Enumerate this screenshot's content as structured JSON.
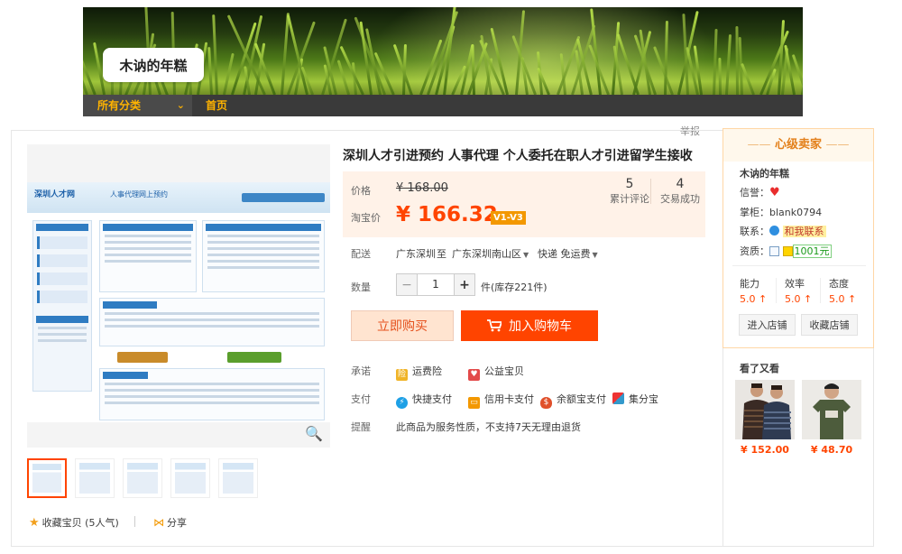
{
  "shop": {
    "banner_name": "木讷的年糕"
  },
  "nav": {
    "all_categories": "所有分类",
    "chevron": "⌄",
    "home": "首页"
  },
  "report": "举报",
  "product": {
    "title": "深圳人才引进预约 人事代理 个人委托在职人才引进留学生接收",
    "price_label": "价格",
    "original_price": "¥ 168.00",
    "taobao_price_label": "淘宝价",
    "sale_price": "¥ 166.32",
    "vip_badge": "V1-V3",
    "reviews_count": "5",
    "reviews_label": "累计评论",
    "deals_count": "4",
    "deals_label": "交易成功"
  },
  "delivery": {
    "label": "配送",
    "from": "广东深圳",
    "to_word": "至",
    "to": "广东深圳南山区",
    "shipping": "快递 免运费"
  },
  "quantity": {
    "label": "数量",
    "minus": "−",
    "value": "1",
    "plus": "+",
    "unit_stock": "件(库存221件)"
  },
  "actions": {
    "buy_now": "立即购买",
    "add_to_cart": "加入购物车"
  },
  "promise": {
    "label": "承诺",
    "items": [
      "运费险",
      "公益宝贝"
    ]
  },
  "payment": {
    "label": "支付",
    "items": [
      "快捷支付",
      "信用卡支付",
      "余额宝支付",
      "集分宝"
    ]
  },
  "notice": {
    "label": "提醒",
    "text": "此商品为服务性质，不支持7天无理由退货"
  },
  "social": {
    "favorite": "收藏宝贝 (5人气)",
    "share": "分享"
  },
  "seller": {
    "heading": "心级卖家",
    "shop_name": "木讷的年糕",
    "reputation_label": "信誉：",
    "keeper_label": "掌柜：",
    "keeper_name": "blank0794",
    "contact_label": "联系：",
    "contact_text": "和我联系",
    "qualification_label": "资质：",
    "deposit": "1001元",
    "scores": [
      {
        "label": "能力",
        "value": "5.0 ↑"
      },
      {
        "label": "效率",
        "value": "5.0 ↑"
      },
      {
        "label": "态度",
        "value": "5.0 ↑"
      }
    ],
    "enter_shop": "进入店铺",
    "favorite_shop": "收藏店铺"
  },
  "recommend": {
    "title": "看了又看",
    "items": [
      {
        "price": "¥ 152.00"
      },
      {
        "price": "¥ 48.70"
      }
    ]
  },
  "colors": {
    "accent": "#ff4400",
    "nav_text": "#ffb300",
    "seller_heading": "#e3801b"
  }
}
